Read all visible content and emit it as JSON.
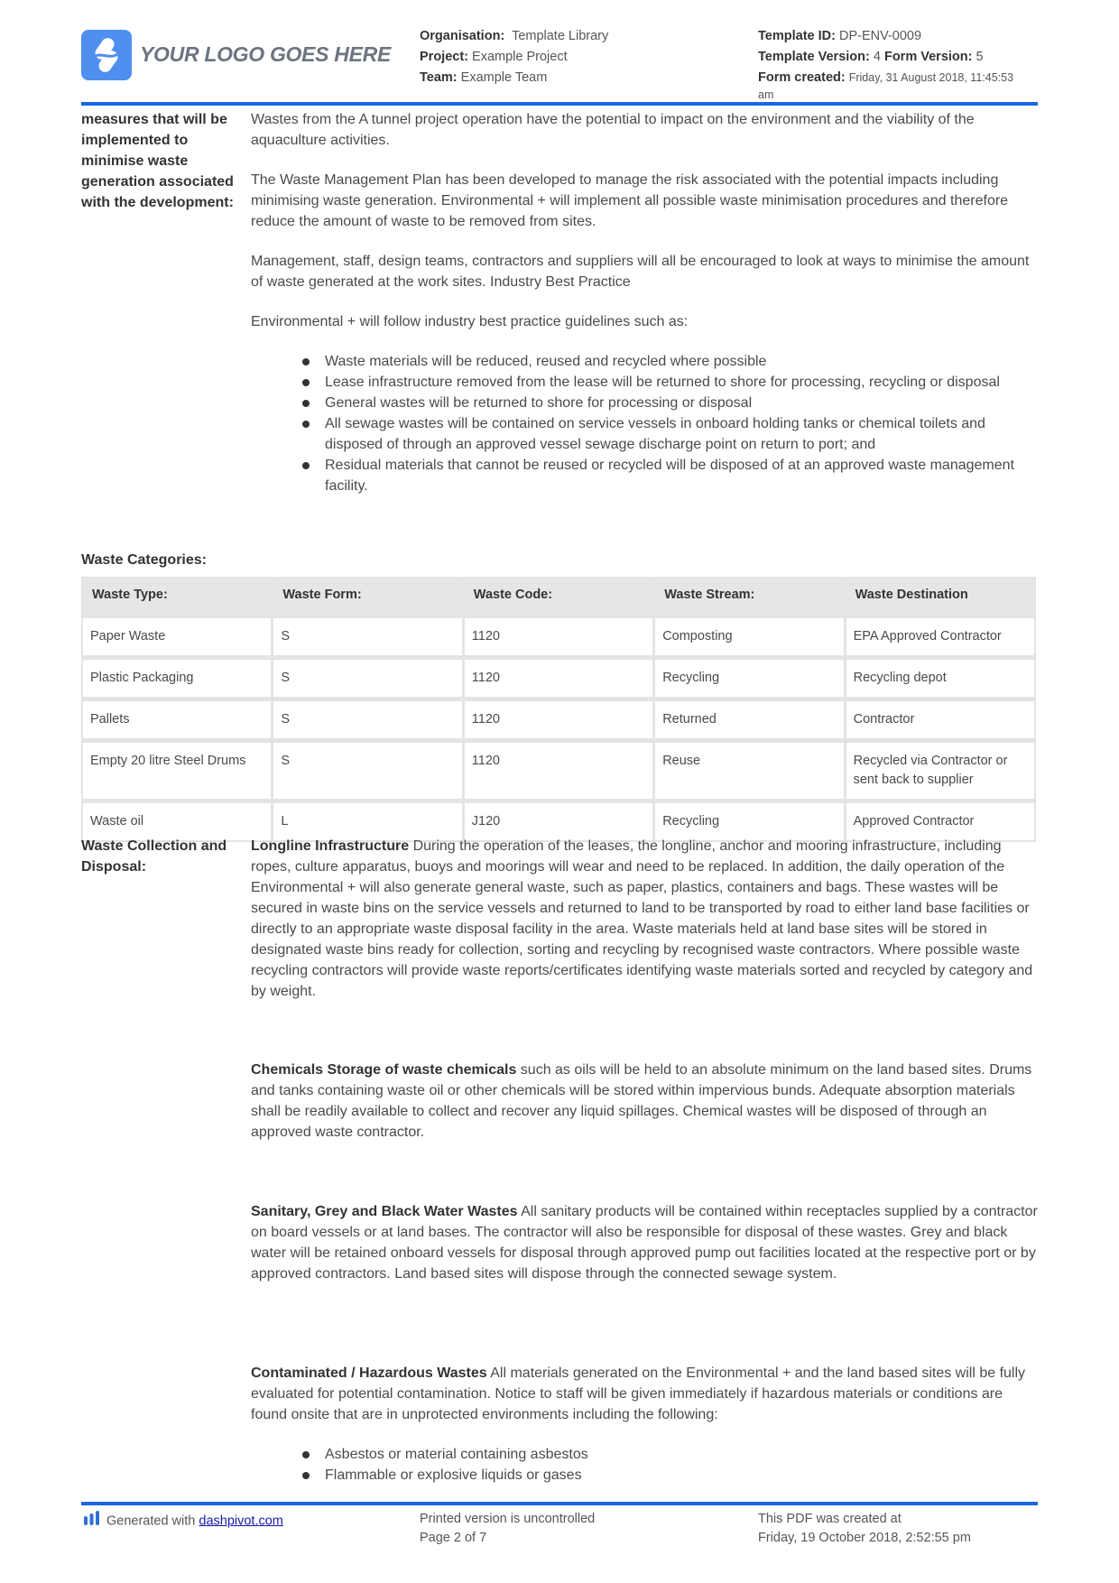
{
  "header": {
    "logo_text": "YOUR LOGO GOES HERE",
    "organisation_label": "Organisation:",
    "organisation_value": "Template Library",
    "project_label": "Project:",
    "project_value": "Example Project",
    "team_label": "Team:",
    "team_value": "Example Team",
    "template_id_label": "Template ID:",
    "template_id_value": "DP-ENV-0009",
    "template_version_label": "Template Version:",
    "template_version_value": "4",
    "form_version_label": "Form Version:",
    "form_version_value": "5",
    "form_created_label": "Form created:",
    "form_created_value": "Friday, 31 August 2018, 11:45:53",
    "form_created_suffix": "am"
  },
  "measures": {
    "label": "measures that will be implemented to minimise waste generation associated with the development:",
    "paragraphs": [
      "Wastes from the A tunnel project operation have the potential to impact on the environment and the viability of the aquaculture activities.",
      "The Waste Management Plan has been developed to manage the risk associated with the potential impacts including minimising waste generation. Environmental + will implement all possible waste minimisation procedures and therefore reduce the amount of waste to be removed from sites.",
      "Management, staff, design teams, contractors and suppliers will all be encouraged to look at ways to minimise the amount of waste generated at the work sites. Industry Best Practice",
      "Environmental + will follow industry best practice guidelines such as:"
    ],
    "bullets": [
      "Waste materials will be reduced, reused and recycled where possible",
      "Lease infrastructure removed from the lease will be returned to shore for processing, recycling or disposal",
      "General wastes will be returned to shore for processing or disposal",
      "All sewage wastes will be contained on service vessels in onboard holding tanks or chemical toilets and disposed of through an approved vessel sewage discharge point on return to port; and",
      "Residual materials that cannot be reused or recycled will be disposed of at an approved waste management facility."
    ]
  },
  "waste_categories": {
    "title": "Waste Categories:",
    "columns": [
      "Waste Type:",
      "Waste Form:",
      "Waste Code:",
      "Waste Stream:",
      "Waste Destination"
    ],
    "rows": [
      [
        "Paper Waste",
        "S",
        "1120",
        "Composting",
        "EPA Approved Contractor"
      ],
      [
        "Plastic Packaging",
        "S",
        "1120",
        "Recycling",
        "Recycling depot"
      ],
      [
        "Pallets",
        "S",
        "1120",
        "Returned",
        "Contractor"
      ],
      [
        "Empty 20 litre Steel Drums",
        "S",
        "1120",
        "Reuse",
        "Recycled via Contractor or sent back to supplier"
      ],
      [
        "Waste oil",
        "L",
        "J120",
        "Recycling",
        "Approved Contractor"
      ]
    ]
  },
  "collection": {
    "label": "Waste Collection and Disposal:",
    "sections": [
      {
        "heading": "Longline Infrastructure",
        "text": " During the operation of the leases, the longline, anchor and mooring infrastructure, including ropes, culture apparatus, buoys and moorings will wear and need to be replaced. In addition, the daily operation of the Environmental + will also generate general waste, such as paper, plastics, containers and bags. These wastes will be secured in waste bins on the service vessels and returned to land to be transported by road to either land base facilities or directly to an appropriate waste disposal facility in the area. Waste materials held at land base sites will be stored in designated waste bins ready for collection, sorting and recycling by recognised waste contractors. Where possible waste recycling contractors will provide waste reports/certificates identifying waste materials sorted and recycled by category and by weight."
      },
      {
        "heading": "Chemicals Storage of waste chemicals",
        "text": " such as oils will be held to an absolute minimum on the land based sites. Drums and tanks containing waste oil or other chemicals will be stored within impervious bunds. Adequate absorption materials shall be readily available to collect and recover any liquid spillages. Chemical wastes will be disposed of through an approved waste contractor."
      },
      {
        "heading": "Sanitary, Grey and Black Water Wastes",
        "text": " All sanitary products will be contained within receptacles supplied by a contractor on board vessels or at land bases. The contractor will also be responsible for disposal of these wastes. Grey and black water will be retained onboard vessels for disposal through approved pump out facilities located at the respective port or by approved contractors. Land based sites will dispose through the connected sewage system."
      },
      {
        "heading": "Contaminated / Hazardous Wastes",
        "text": " All materials generated on the Environmental + and the land based sites will be fully evaluated for potential contamination. Notice to staff will be given immediately if hazardous materials or conditions are found onsite that are in unprotected environments including the following:"
      }
    ],
    "hazard_bullets": [
      "Asbestos or material containing asbestos",
      "Flammable or explosive liquids or gases"
    ]
  },
  "footer": {
    "generated_prefix": "Generated with ",
    "generated_link": "dashpivot.com",
    "printed_notice": "Printed version is uncontrolled",
    "page_label": "Page 2 of 7",
    "pdf_created_label": "This PDF was created at",
    "pdf_created_value": "Friday, 19 October 2018, 2:52:55 pm"
  },
  "colors": {
    "accent_rule": "#1a66e6",
    "logo_blue": "#4f8ff0",
    "table_header_bg": "#e6e6e6",
    "link": "#1a1aa6"
  }
}
